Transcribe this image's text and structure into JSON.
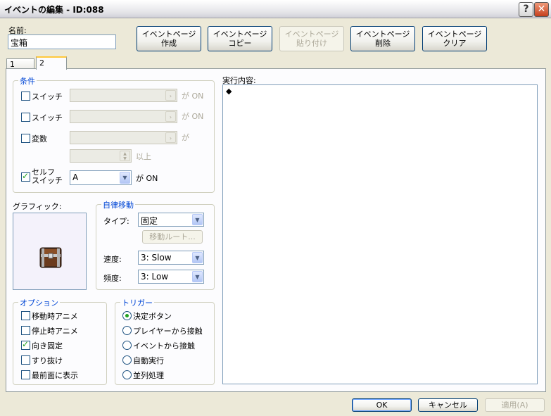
{
  "window": {
    "title": "イベントの編集 - ID:088",
    "help_label": "?",
    "close_label": "✕"
  },
  "name": {
    "label": "名前:",
    "value": "宝箱"
  },
  "page_buttons": [
    {
      "line1": "イベントページ",
      "line2": "作成",
      "enabled": true
    },
    {
      "line1": "イベントページ",
      "line2": "コピー",
      "enabled": true
    },
    {
      "line1": "イベントページ",
      "line2": "貼り付け",
      "enabled": false
    },
    {
      "line1": "イベントページ",
      "line2": "削除",
      "enabled": true
    },
    {
      "line1": "イベントページ",
      "line2": "クリア",
      "enabled": true
    }
  ],
  "tabs": [
    "1",
    "2"
  ],
  "active_tab": "2",
  "conditions": {
    "title": "条件",
    "switch1": {
      "label": "スイッチ",
      "suffix": "が ON",
      "checked": false
    },
    "switch2": {
      "label": "スイッチ",
      "suffix": "が ON",
      "checked": false
    },
    "variable": {
      "label": "変数",
      "suffix": "が",
      "checked": false
    },
    "variable_ge": "以上",
    "self_switch": {
      "label1": "セルフ",
      "label2": "スイッチ",
      "value": "A",
      "suffix": "が ON",
      "checked": true
    }
  },
  "graphic": {
    "label": "グラフィック:"
  },
  "autonomous": {
    "title": "自律移動",
    "type_label": "タイプ:",
    "type_value": "固定",
    "route_button": "移動ルート...",
    "speed_label": "速度:",
    "speed_value": "3: Slow",
    "freq_label": "頻度:",
    "freq_value": "3: Low"
  },
  "options": {
    "title": "オプション",
    "items": [
      {
        "label": "移動時アニメ",
        "checked": false
      },
      {
        "label": "停止時アニメ",
        "checked": false
      },
      {
        "label": "向き固定",
        "checked": true
      },
      {
        "label": "すり抜け",
        "checked": false
      },
      {
        "label": "最前面に表示",
        "checked": false
      }
    ]
  },
  "trigger": {
    "title": "トリガー",
    "items": [
      {
        "label": "決定ボタン",
        "checked": true
      },
      {
        "label": "プレイヤーから接触",
        "checked": false
      },
      {
        "label": "イベントから接触",
        "checked": false
      },
      {
        "label": "自動実行",
        "checked": false
      },
      {
        "label": "並列処理",
        "checked": false
      }
    ]
  },
  "contents": {
    "label": "実行内容:",
    "first_line": "◆"
  },
  "footer": {
    "ok": "OK",
    "cancel": "キャンセル",
    "apply": "適用(A)"
  }
}
